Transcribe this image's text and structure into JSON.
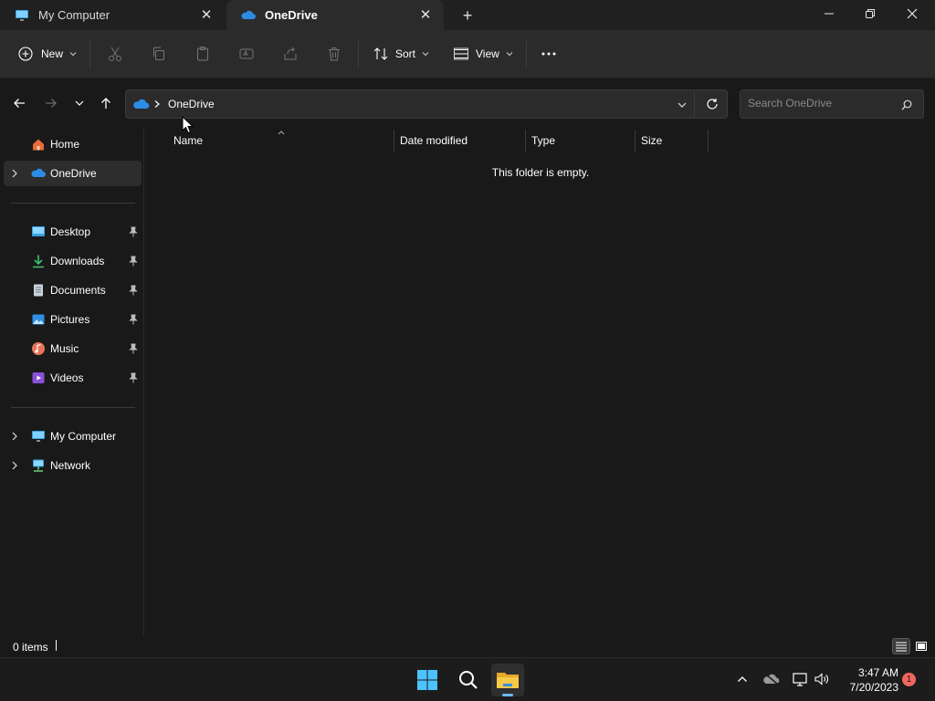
{
  "tabs": [
    {
      "title": "My Computer",
      "icon": "monitor-icon",
      "active": false
    },
    {
      "title": "OneDrive",
      "icon": "cloud-icon",
      "active": true
    }
  ],
  "toolbar": {
    "new_label": "New",
    "sort_label": "Sort",
    "view_label": "View"
  },
  "address": {
    "path": [
      "OneDrive"
    ]
  },
  "search": {
    "placeholder": "Search OneDrive"
  },
  "sidebar": {
    "top": [
      {
        "label": "Home",
        "icon": "home-icon"
      },
      {
        "label": "OneDrive",
        "icon": "cloud-icon",
        "selected": true
      }
    ],
    "pinned": [
      {
        "label": "Desktop",
        "icon": "desktop-icon"
      },
      {
        "label": "Downloads",
        "icon": "download-icon"
      },
      {
        "label": "Documents",
        "icon": "document-icon"
      },
      {
        "label": "Pictures",
        "icon": "picture-icon"
      },
      {
        "label": "Music",
        "icon": "music-icon"
      },
      {
        "label": "Videos",
        "icon": "video-icon"
      }
    ],
    "bottom": [
      {
        "label": "My Computer",
        "icon": "monitor-icon"
      },
      {
        "label": "Network",
        "icon": "network-icon"
      }
    ]
  },
  "columns": [
    "Name",
    "Date modified",
    "Type",
    "Size"
  ],
  "empty_message": "This folder is empty.",
  "status": {
    "item_count": "0 items"
  },
  "taskbar": {
    "time": "3:47 AM",
    "date": "7/20/2023",
    "notification_count": "1"
  },
  "colors": {
    "accent": "#6fb7ff",
    "background": "#191919",
    "toolbar": "#2b2b2b",
    "notification": "#f0675f"
  }
}
